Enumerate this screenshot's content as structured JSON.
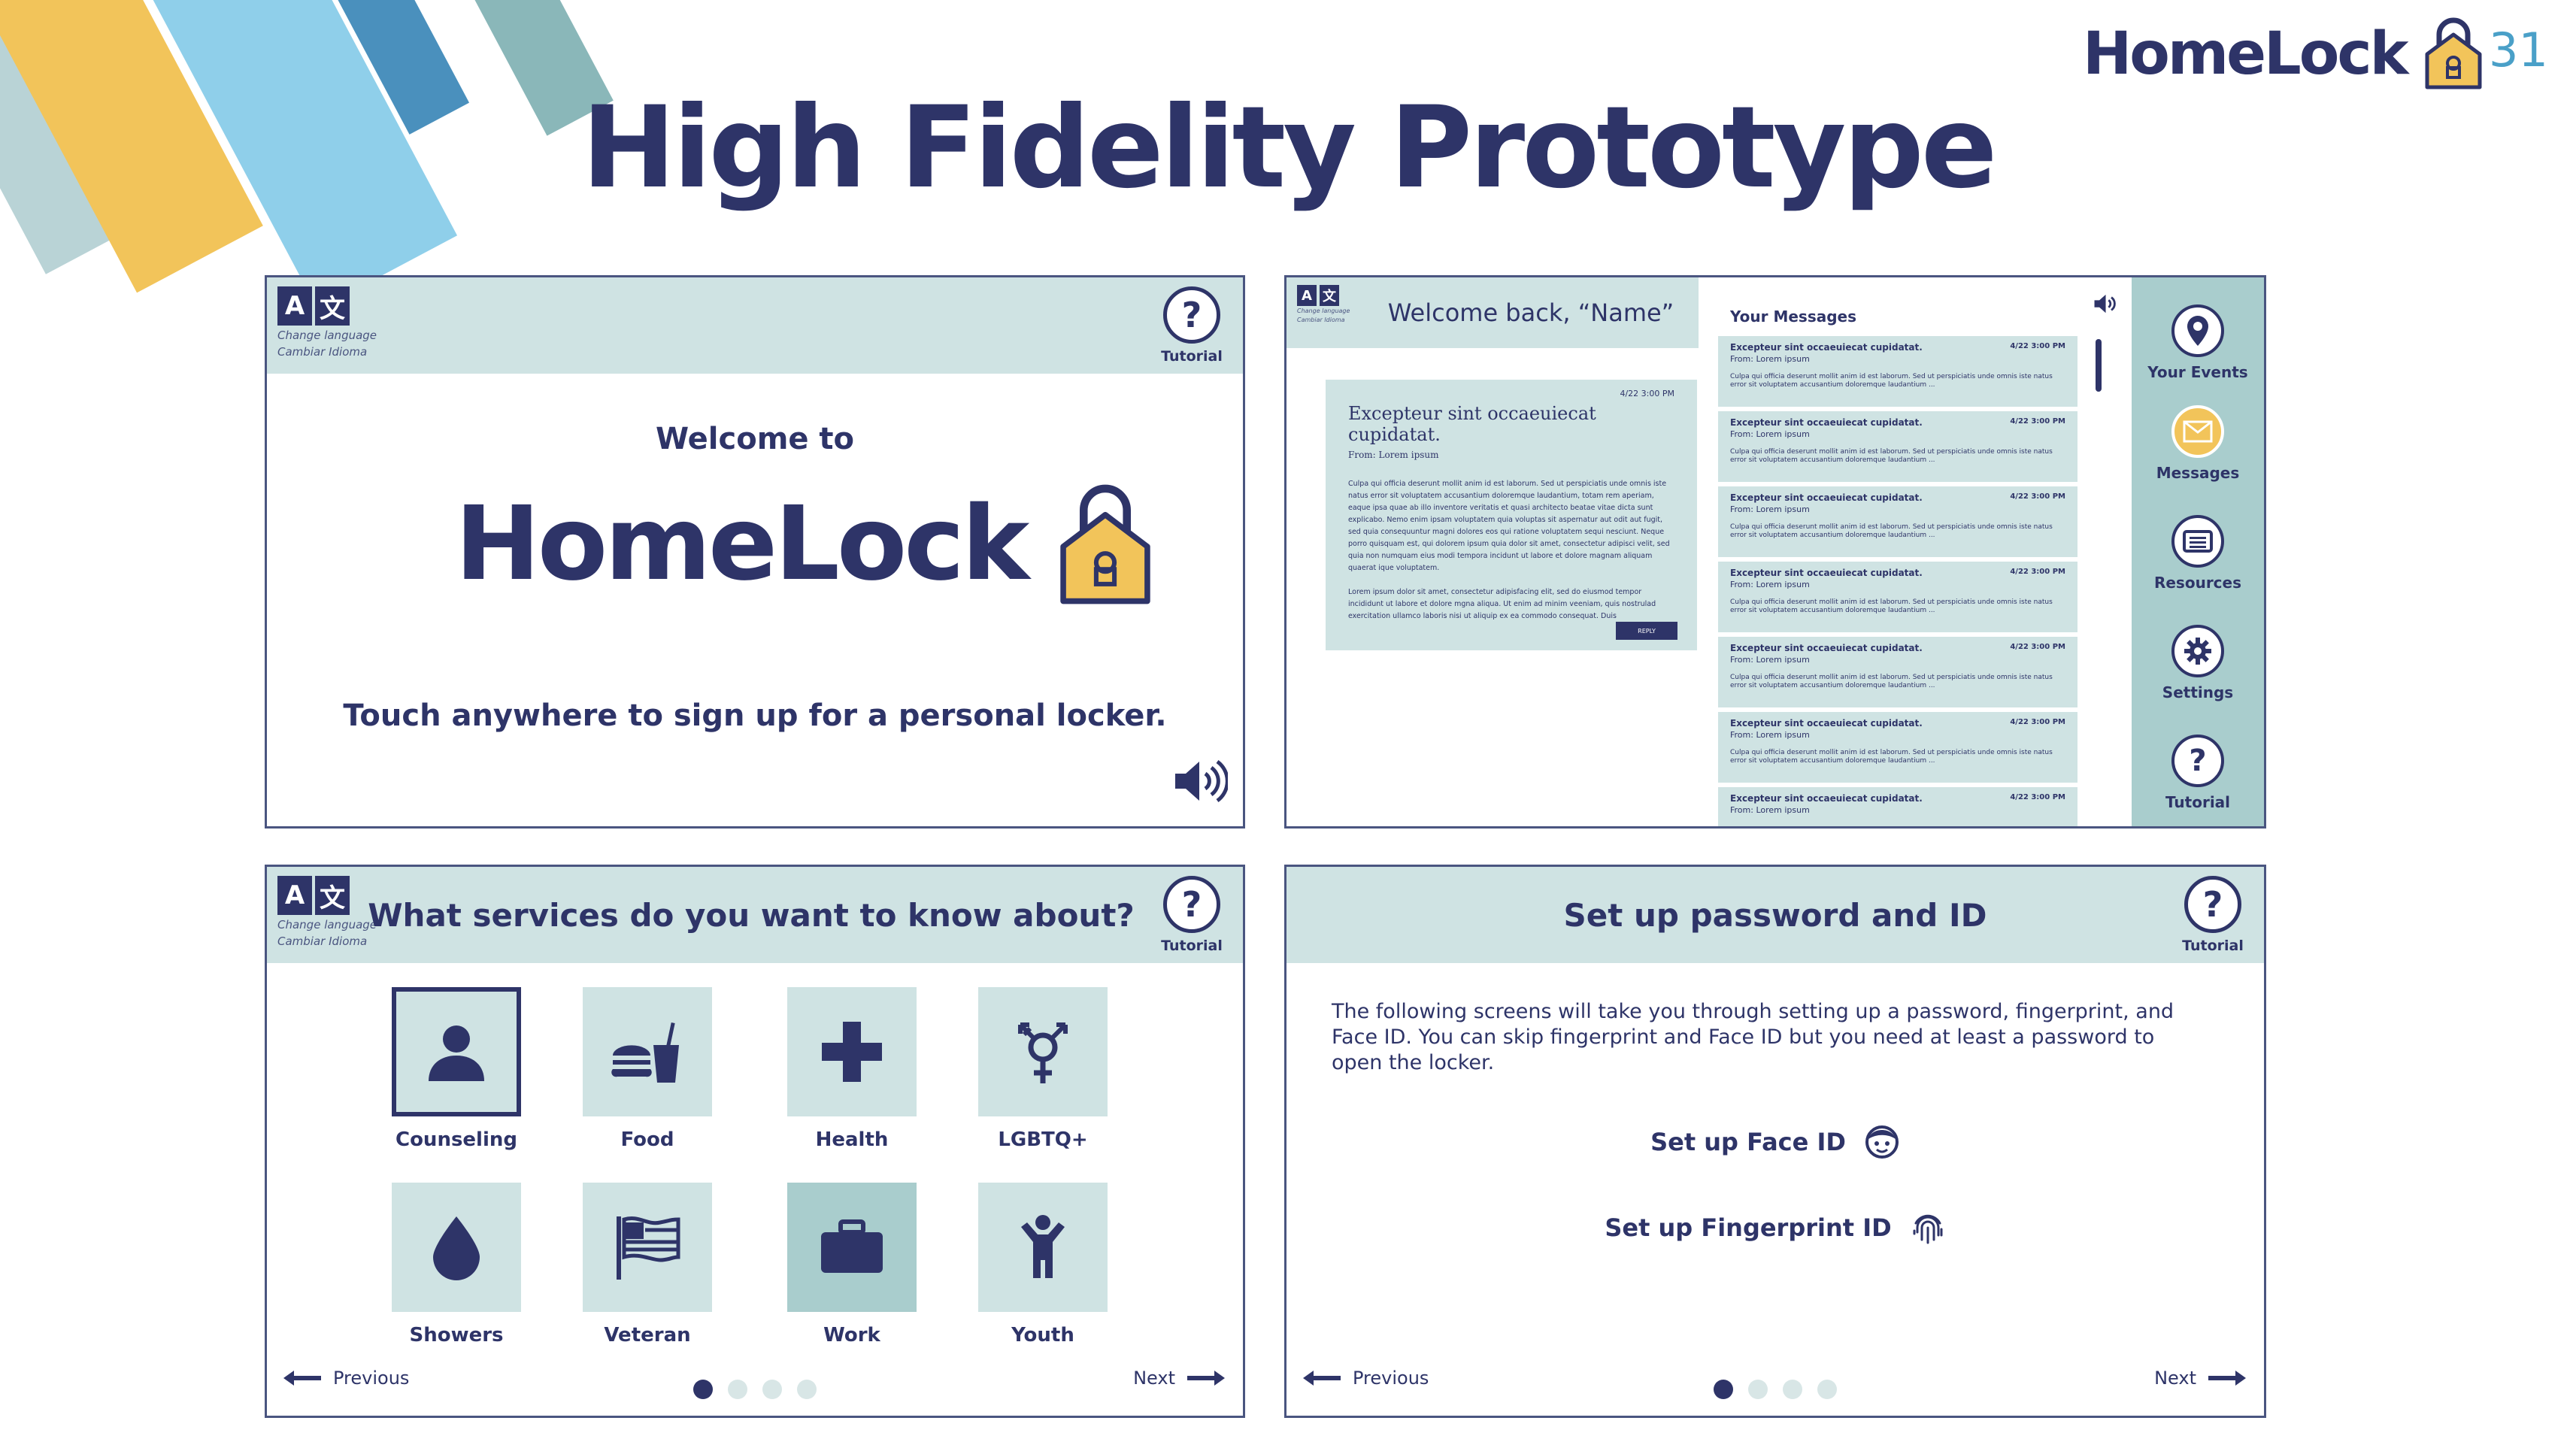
{
  "slide": {
    "title": "High Fidelity Prototype",
    "brand": "HomeLock",
    "page_number": "31"
  },
  "common": {
    "change_language_en": "Change language",
    "change_language_es": "Cambiar Idioma",
    "tutorial": "Tutorial",
    "previous": "Previous",
    "next": "Next"
  },
  "welcome_screen": {
    "welcome_to": "Welcome to",
    "brand": "HomeLock",
    "touch_prompt": "Touch anywhere to sign up for a personal locker."
  },
  "messages_screen": {
    "greeting": "Welcome back, “Name”",
    "your_messages": "Your Messages",
    "detail": {
      "date": "4/22 3:00 PM",
      "subject": "Excepteur sint occaeuiecat cupidatat.",
      "from": "From: Lorem ipsum",
      "body": "Culpa qui officia deserunt mollit anim id est laborum. Sed ut perspiciatis unde omnis iste natus error sit voluptatem accusantium doloremque laudantium, totam rem aperiam, eaque ipsa quae ab illo inventore veritatis et quasi architecto beatae vitae dicta sunt explicabo. Nemo enim ipsam voluptatem quia voluptas sit aspernatur aut odit aut fugit, sed quia consequuntur magni dolores eos qui ratione voluptatem sequi nesciunt. Neque porro quisquam est, qui dolorem ipsum quia dolor sit amet, consectetur adipisci velit, sed quia non numquam eius modi tempora incidunt ut labore et dolore magnam aliquam quaerat ique voluptatem.",
      "body2": "Lorem ipsum dolor sit amet, consectetur adipisfacing elit, sed do eiusmod tempor incididunt ut labore et dolore mgna aliqua. Ut enim ad minim veeniam, quis nostrulad exercitation ullamco laboris nisi ut aliquip ex ea commodo consequat. Duis",
      "reply": "REPLY"
    },
    "messages": [
      {
        "subject": "Excepteur sint occaeuiecat cupidatat.",
        "date": "4/22 3:00 PM",
        "from": "From: Lorem ipsum",
        "body": "Culpa qui officia deserunt mollit anim id est laborum. Sed ut perspiciatis unde omnis iste natus error sit voluptatem accusantium doloremque laudantium ..."
      },
      {
        "subject": "Excepteur sint occaeuiecat cupidatat.",
        "date": "4/22 3:00 PM",
        "from": "From: Lorem ipsum",
        "body": "Culpa qui officia deserunt mollit anim id est laborum. Sed ut perspiciatis unde omnis iste natus error sit voluptatem accusantium doloremque laudantium ..."
      },
      {
        "subject": "Excepteur sint occaeuiecat cupidatat.",
        "date": "4/22 3:00 PM",
        "from": "From: Lorem ipsum",
        "body": "Culpa qui officia deserunt mollit anim id est laborum. Sed ut perspiciatis unde omnis iste natus error sit voluptatem accusantium doloremque laudantium ..."
      },
      {
        "subject": "Excepteur sint occaeuiecat cupidatat.",
        "date": "4/22 3:00 PM",
        "from": "From: Lorem ipsum",
        "body": "Culpa qui officia deserunt mollit anim id est laborum. Sed ut perspiciatis unde omnis iste natus error sit voluptatem accusantium doloremque laudantium ..."
      },
      {
        "subject": "Excepteur sint occaeuiecat cupidatat.",
        "date": "4/22 3:00 PM",
        "from": "From: Lorem ipsum",
        "body": "Culpa qui officia deserunt mollit anim id est laborum. Sed ut perspiciatis unde omnis iste natus error sit voluptatem accusantium doloremque laudantium ..."
      },
      {
        "subject": "Excepteur sint occaeuiecat cupidatat.",
        "date": "4/22 3:00 PM",
        "from": "From: Lorem ipsum",
        "body": "Culpa qui officia deserunt mollit anim id est laborum. Sed ut perspiciatis unde omnis iste natus error sit voluptatem accusantium doloremque laudantium ..."
      },
      {
        "subject": "Excepteur sint occaeuiecat cupidatat.",
        "date": "4/22 3:00 PM",
        "from": "From: Lorem ipsum",
        "body": ""
      }
    ],
    "nav": [
      {
        "label": "Your Events",
        "icon": "location-pin-icon"
      },
      {
        "label": "Messages",
        "icon": "envelope-icon"
      },
      {
        "label": "Resources",
        "icon": "list-icon"
      },
      {
        "label": "Settings",
        "icon": "gear-icon"
      },
      {
        "label": "Tutorial",
        "icon": "question-icon"
      }
    ]
  },
  "services_screen": {
    "title": "What services do you want to know about?",
    "services": [
      {
        "label": "Counseling",
        "icon": "person-icon",
        "selected": true
      },
      {
        "label": "Food",
        "icon": "burger-drink-icon"
      },
      {
        "label": "Health",
        "icon": "medical-cross-icon"
      },
      {
        "label": "LGBTQ+",
        "icon": "gender-symbol-icon"
      },
      {
        "label": "Showers",
        "icon": "water-drop-icon"
      },
      {
        "label": "Veteran",
        "icon": "flag-icon"
      },
      {
        "label": "Work",
        "icon": "briefcase-icon",
        "highlighted": true
      },
      {
        "label": "Youth",
        "icon": "child-icon"
      }
    ],
    "page_dots": 4,
    "active_dot": 1
  },
  "password_screen": {
    "title": "Set up password and ID",
    "description": "The following screens will take you through setting up a password, fingerprint, and Face ID. You can skip fingerprint and Face ID but you need at least a password to open the locker.",
    "face_id": "Set up Face ID",
    "fingerprint": "Set up Fingerprint ID",
    "page_dots": 4,
    "active_dot": 1
  },
  "colors": {
    "navy": "#2e3468",
    "panel_light": "#cfe3e3",
    "panel_mid": "#a9cdcd",
    "lock_yellow": "#f2c45a",
    "stripe_blue": "#8fcfea",
    "stripe_dark_blue": "#4a90bd",
    "stripe_teal": "#8ab7b9",
    "stripe_gray": "#b9d3d6"
  }
}
